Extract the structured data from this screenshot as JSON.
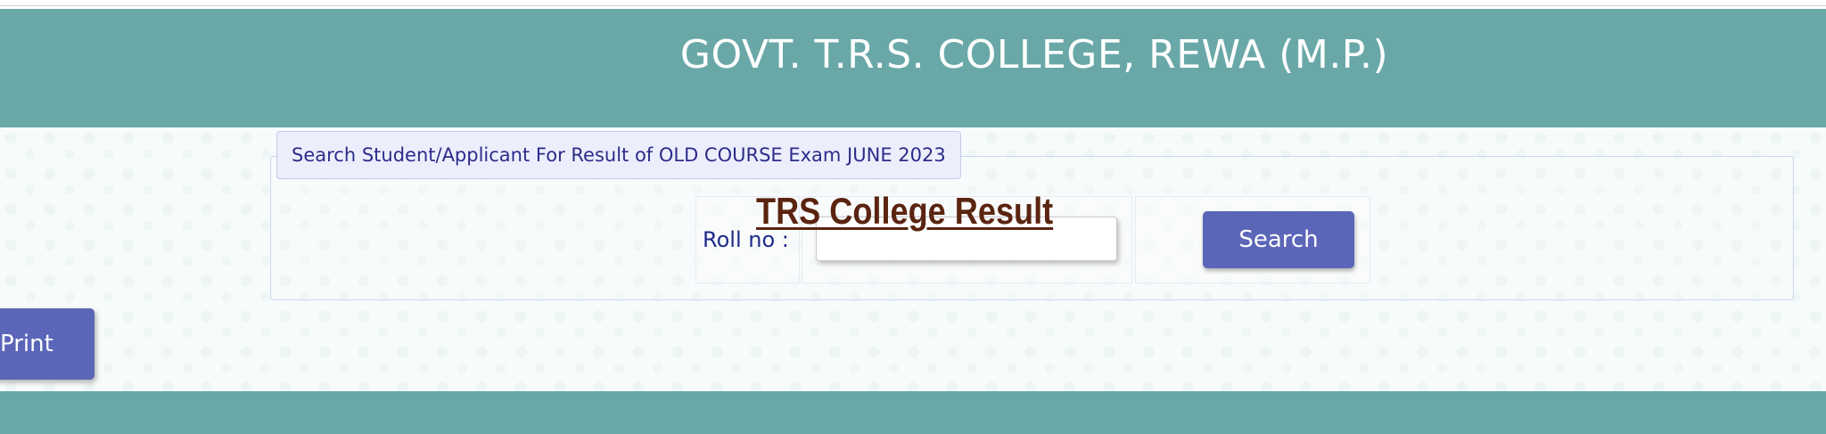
{
  "header": {
    "title": "GOVT. T.R.S. COLLEGE, REWA (M.P.)"
  },
  "search_form": {
    "legend": "Search Student/Applicant For Result of OLD COURSE Exam JUNE 2023",
    "roll_label": "Roll no :",
    "roll_value": "",
    "roll_placeholder": "",
    "search_label": "Search"
  },
  "watermark": {
    "text": "TRS College Result"
  },
  "actions": {
    "print_label": "Print"
  },
  "colors": {
    "header_bg": "#6aa8a8",
    "button_bg": "#5b66b8",
    "watermark": "#5a2410",
    "legend_text": "#2c2c8a"
  }
}
